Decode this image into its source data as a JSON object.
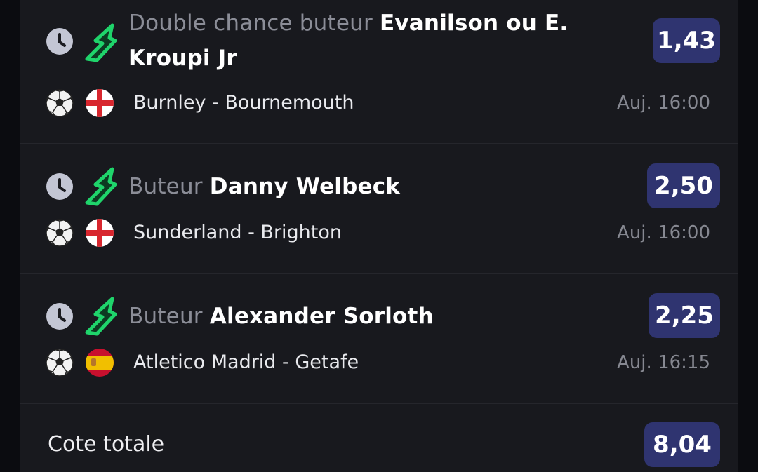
{
  "bets": [
    {
      "bet_type": "Double chance buteur",
      "player": "Evanilson ou E. Kroupi Jr",
      "odd": "1,43",
      "match": "Burnley - Bournemouth",
      "time": "Auj. 16:00",
      "sport_icon": "soccer-ball-icon",
      "flag_icon": "england-flag-icon"
    },
    {
      "bet_type": "Buteur",
      "player": "Danny Welbeck",
      "odd": "2,50",
      "match": "Sunderland - Brighton",
      "time": "Auj. 16:00",
      "sport_icon": "soccer-ball-icon",
      "flag_icon": "england-flag-icon"
    },
    {
      "bet_type": "Buteur",
      "player": "Alexander Sorloth",
      "odd": "2,25",
      "match": "Atletico Madrid - Getafe",
      "time": "Auj. 16:15",
      "sport_icon": "soccer-ball-icon",
      "flag_icon": "spain-flag-icon"
    }
  ],
  "total": {
    "label": "Cote totale",
    "odd": "8,04"
  },
  "colors": {
    "background": "#18191e",
    "odd_badge": "#2f3470",
    "boost_green": "#1fd46b",
    "muted_text": "#8b8d97"
  }
}
